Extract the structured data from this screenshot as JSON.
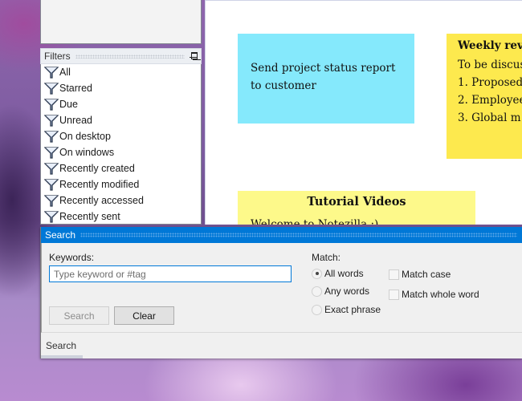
{
  "sidebar": {
    "filters_title": "Filters",
    "pin_icon": "pin-icon",
    "filter_icon": "funnel-icon",
    "filters": [
      {
        "label": "All"
      },
      {
        "label": "Starred"
      },
      {
        "label": "Due"
      },
      {
        "label": "Unread"
      },
      {
        "label": "On desktop"
      },
      {
        "label": "On windows"
      },
      {
        "label": "Recently created"
      },
      {
        "label": "Recently modified"
      },
      {
        "label": "Recently accessed"
      },
      {
        "label": "Recently sent"
      }
    ]
  },
  "notes": [
    {
      "color": "#85e9fc",
      "text": "Send project status report to customer"
    },
    {
      "color": "#fde94e",
      "title": "Weekly review",
      "lines": [
        "To be discussed:",
        "1. Proposed",
        "2. Employee",
        "3. Global m"
      ]
    },
    {
      "color": "#fdf98a",
      "title": "Tutorial Videos",
      "text": "Welcome to Notezilla :)"
    }
  ],
  "search_panel": {
    "title": "Search",
    "accent_color": "#0078d7",
    "keywords_label": "Keywords:",
    "keywords_value": "",
    "keywords_placeholder": "Type keyword or #tag",
    "search_button": "Search",
    "clear_button": "Clear",
    "match_label": "Match:",
    "match_options": [
      {
        "label": "All words",
        "checked": true
      },
      {
        "label": "Any words",
        "checked": false
      },
      {
        "label": "Exact phrase",
        "checked": false
      }
    ],
    "checkboxes": [
      {
        "label": "Match case",
        "checked": false
      },
      {
        "label": "Match whole word",
        "checked": false
      }
    ],
    "bottom_tab": "Search"
  }
}
